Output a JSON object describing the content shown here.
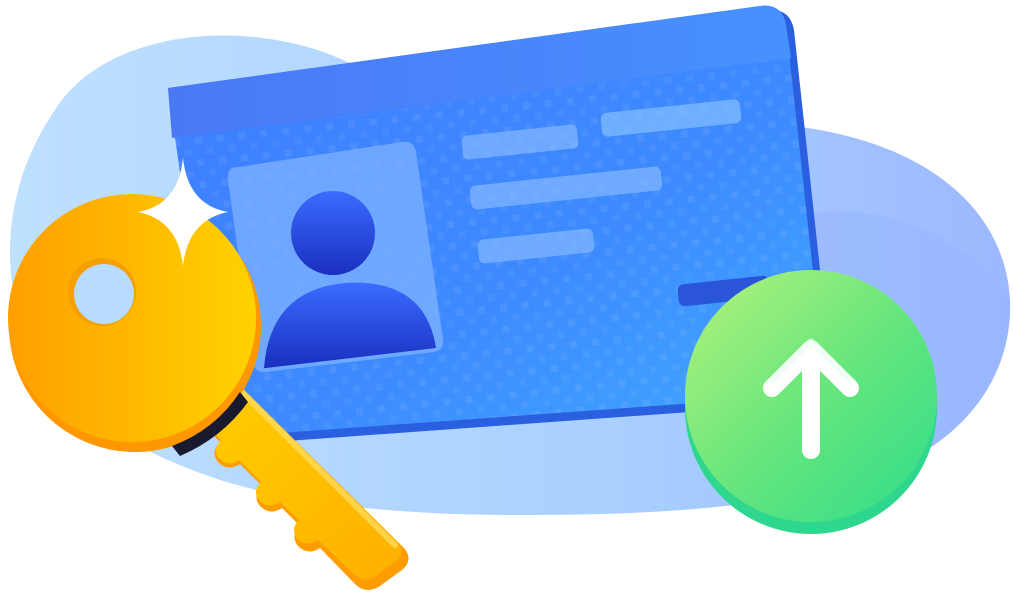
{
  "illustration": {
    "subject": "id-card-key-upload",
    "elements": {
      "background": "blob-background",
      "card": "id-card",
      "portrait": "user-icon",
      "key": "key-icon",
      "sparkle": "sparkle-icon",
      "upload": "arrow-up-icon"
    },
    "colors": {
      "blob_light": "#cfe6ff",
      "blob_mid": "#9fc6ff",
      "card_top": "#3c8cff",
      "card_bottom": "#2b6ef2",
      "card_header": "#4a7af5",
      "key_gold": "#ffb300",
      "key_light": "#ffd400",
      "upload_green_top": "#a7f07a",
      "upload_green_bottom": "#22d68a",
      "avatar_blue": "#1f3fcf"
    }
  }
}
